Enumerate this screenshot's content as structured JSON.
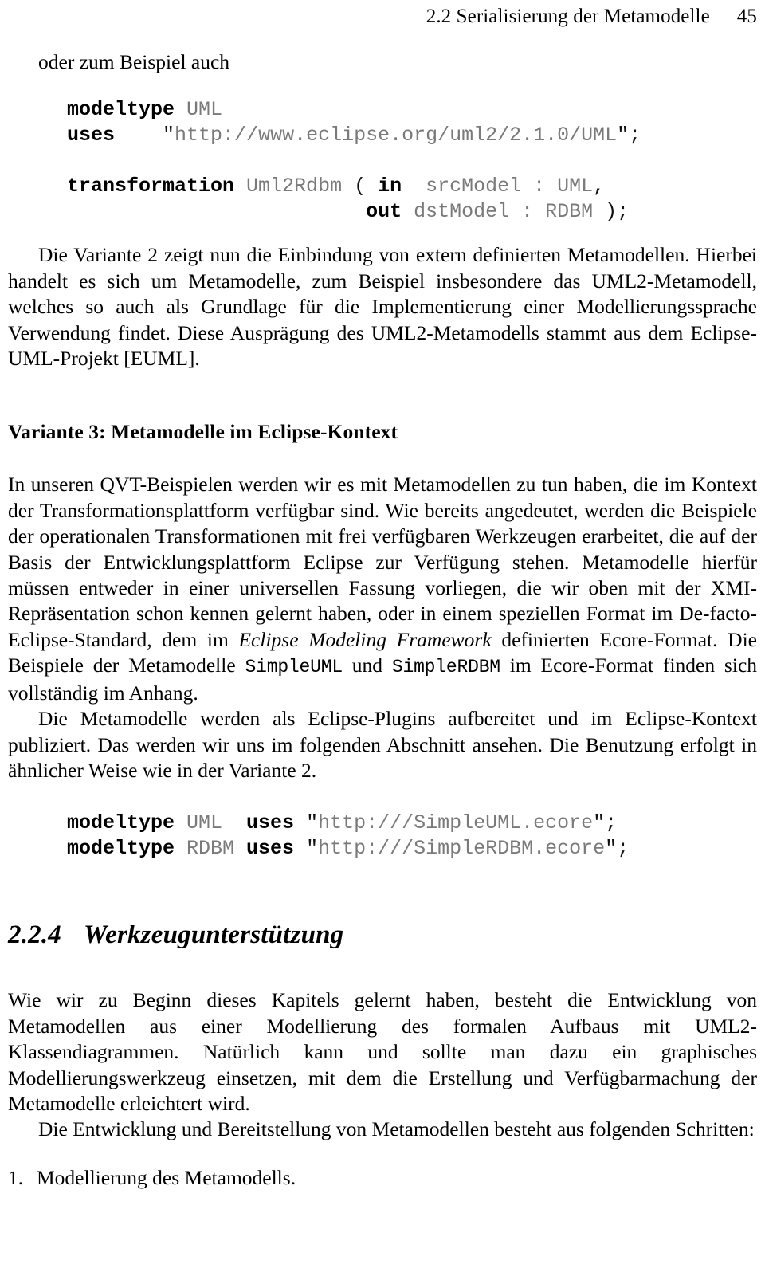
{
  "running_head": {
    "title": "2.2 Serialisierung der Metamodelle",
    "page_number": "45"
  },
  "intro_line": "oder zum Beispiel auch",
  "code_block_1": {
    "lines": [
      {
        "kw": "modeltype",
        "rest": " UML"
      },
      {
        "kw": "uses",
        "rest": "    \"http://www.eclipse.org/uml2/2.1.0/UML\";"
      },
      {
        "kw": "",
        "rest": ""
      },
      {
        "kw": "transformation",
        "rest": " Uml2Rdbm ( in  srcModel : UML,"
      },
      {
        "kw": "",
        "rest": "                         out dstModel : RDBM );"
      }
    ],
    "full_text": "modeltype UML\nuses    \"http://www.eclipse.org/uml2/2.1.0/UML\";\n\ntransformation Uml2Rdbm ( in  srcModel : UML,\n                         out dstModel : RDBM );",
    "keyword_color": "#000000",
    "literal_color": "#7a7a7a"
  },
  "paragraph_1": "Die Variante 2 zeigt nun die Einbindung von extern definierten Metamodellen. Hierbei handelt es sich um Metamodelle, zum Beispiel insbesondere das UML2-Metamodell, welches so auch als Grundlage für die Implementierung einer Modellierungssprache Verwendung findet. Diese Ausprägung des UML2-Metamodells stammt aus dem Eclipse-UML-Projekt [EUML].",
  "subheading_variante3": "Variante 3: Metamodelle im Eclipse-Kontext",
  "paragraph_2": {
    "part_1": "In unseren QVT-Beispielen werden wir es mit Metamodellen zu tun haben, die im Kontext der Transformationsplattform verfügbar sind. Wie bereits angedeutet, werden die Beispiele der operationalen Transformationen mit frei verfügbaren Werkzeugen erarbeitet, die auf der Basis der Entwicklungsplattform Eclipse zur Verfügung stehen. Metamodelle hierfür müssen entweder in einer universellen Fassung vorliegen, die wir oben mit der XMI-Repräsentation schon kennen gelernt haben, oder in einem speziellen Format im De-facto-Eclipse-Standard, dem im ",
    "emphasis_1": "Eclipse Modeling Framework",
    "part_2": " definierten Ecore-Format. Die Beispiele der Metamodelle ",
    "code_1": "SimpleUML",
    "part_3": " und ",
    "code_2": "SimpleRDBM",
    "part_4": " im Ecore-Format finden sich vollständig im Anhang."
  },
  "paragraph_3": "Die Metamodelle werden als Eclipse-Plugins aufbereitet und im Eclipse-Kontext publiziert. Das werden wir uns im folgenden Abschnitt ansehen. Die Benutzung erfolgt in ähnlicher Weise wie in der Variante 2.",
  "code_block_2": {
    "lines": [
      {
        "kw": "modeltype",
        "mid": " UML  ",
        "kw2": "uses",
        "rest": " \"http:///SimpleUML.ecore\";"
      },
      {
        "kw": "modeltype",
        "mid": " RDBM ",
        "kw2": "uses",
        "rest": " \"http:///SimpleRDBM.ecore\";"
      }
    ],
    "full_text": "modeltype UML  uses \"http:///SimpleUML.ecore\";\nmodeltype RDBM uses \"http:///SimpleRDBM.ecore\";"
  },
  "section_heading": {
    "number": "2.2.4",
    "title": "Werkzeugunterstützung"
  },
  "paragraph_4": "Wie wir zu Beginn dieses Kapitels gelernt haben, besteht die Entwicklung von Metamodellen aus einer Modellierung des formalen Aufbaus mit UML2-Klassendiagrammen. Natürlich kann und sollte man dazu ein graphisches Modellierungswerkzeug einsetzen, mit dem die Erstellung und Verfügbarmachung der Metamodelle erleichtert wird.",
  "paragraph_5": "Die Entwicklung und Bereitstellung von Metamodellen besteht aus folgenden Schritten:",
  "list_items": [
    {
      "number": "1.",
      "text": "Modellierung des Metamodells."
    }
  ]
}
